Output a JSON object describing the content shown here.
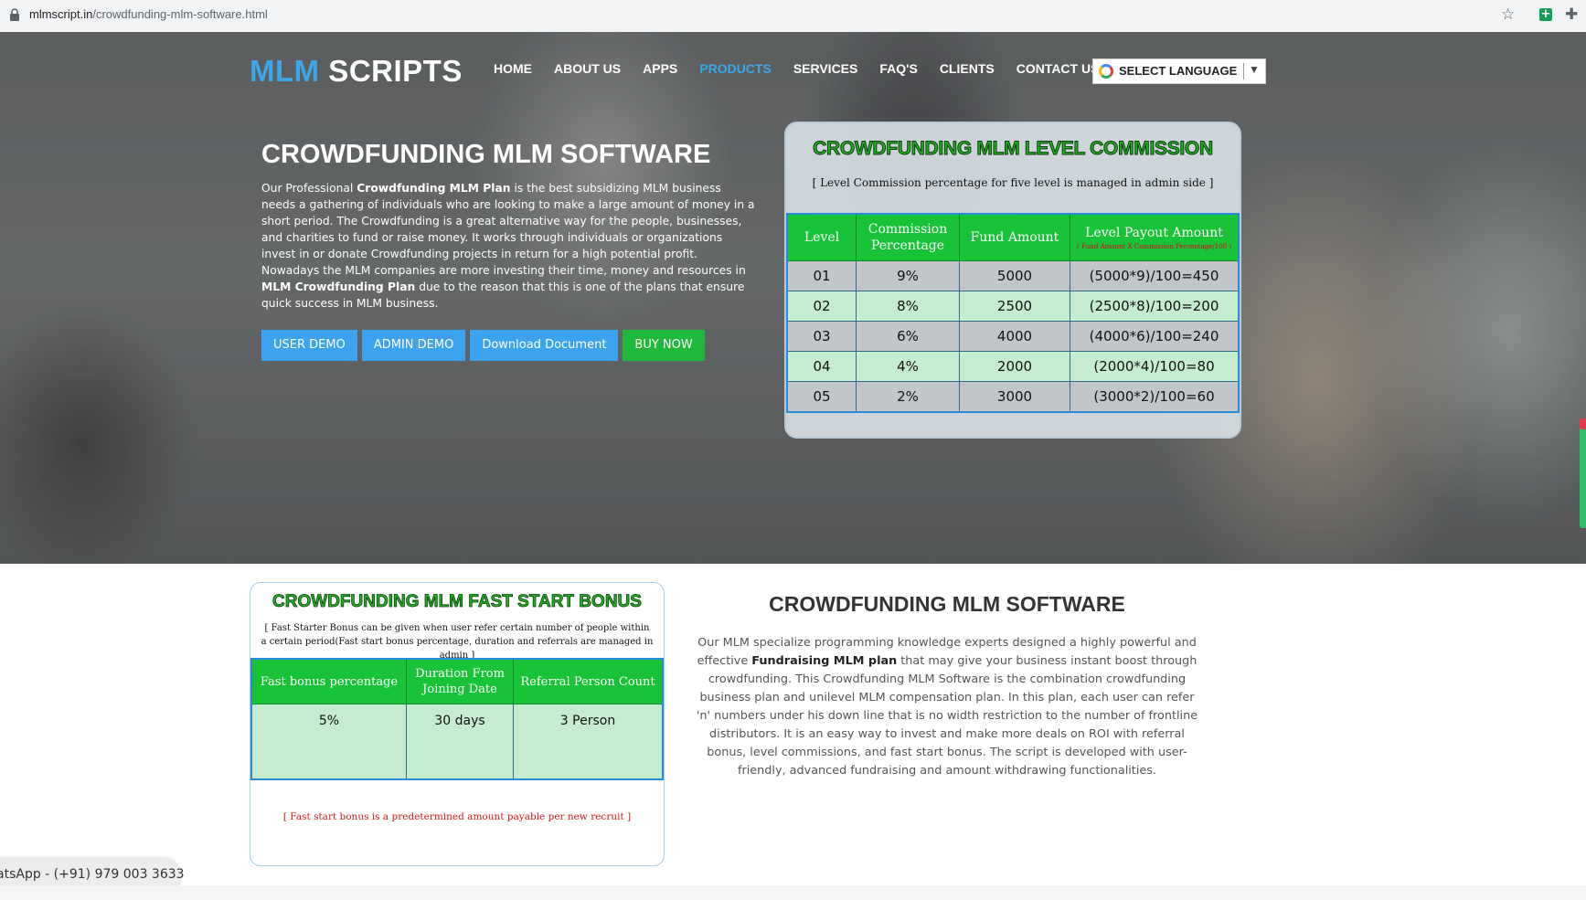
{
  "browser": {
    "url_domain": "mlmscript.in",
    "url_path": "/crowdfunding-mlm-software.html"
  },
  "logo": {
    "part1": "MLM",
    "part2": " SCRIPTS"
  },
  "nav": {
    "items": [
      {
        "label": "HOME"
      },
      {
        "label": "ABOUT US"
      },
      {
        "label": "APPS"
      },
      {
        "label": "PRODUCTS"
      },
      {
        "label": "SERVICES"
      },
      {
        "label": "FAQ'S"
      },
      {
        "label": "CLIENTS"
      },
      {
        "label": "CONTACT US"
      }
    ],
    "active_index": 3,
    "active_color": "#3ba7e8"
  },
  "language": {
    "label": "SELECT LANGUAGE",
    "arrow": "▼"
  },
  "hero": {
    "title": "CROWDFUNDING MLM SOFTWARE",
    "p1": "Our Professional ",
    "b1": "Crowdfunding MLM Plan",
    "p2": " is the best subsidizing MLM business needs a gathering of individuals who are looking to make a large amount of money in a short period. The Crowdfunding is a great alternative way for the people, businesses, and charities to fund or raise money. It works through individuals or organizations invest in or donate Crowdfunding projects in return for a high potential profit. Nowadays the MLM companies are more investing their time, money and resources in ",
    "b2": "MLM Crowdfunding Plan",
    "p3": " due to the reason that this is one of the plans that ensure quick success in MLM business.",
    "buttons": {
      "user_demo": "USER DEMO",
      "admin_demo": "ADMIN DEMO",
      "download": "Download Document",
      "buy_now": "BUY NOW"
    }
  },
  "level_commission": {
    "title": "CROWDFUNDING MLM LEVEL COMMISSION",
    "subtitle": "[   Level Commission percentage for five level is managed in admin side    ]",
    "headers": {
      "level": "Level",
      "commission_1": "Commission",
      "commission_2": "Percentage",
      "fund": "Fund Amount",
      "payout": "Level Payout Amount",
      "payout_formula": "( Fund Amount X Commission Percentage/100 )"
    },
    "rows": [
      {
        "level": "01",
        "pct": "9%",
        "fund": "5000",
        "payout": "(5000*9)/100=450"
      },
      {
        "level": "02",
        "pct": "8%",
        "fund": "2500",
        "payout": "(2500*8)/100=200"
      },
      {
        "level": "03",
        "pct": "6%",
        "fund": "4000",
        "payout": "(4000*6)/100=240"
      },
      {
        "level": "04",
        "pct": "4%",
        "fund": "2000",
        "payout": "(2000*4)/100=80"
      },
      {
        "level": "05",
        "pct": "2%",
        "fund": "3000",
        "payout": "(3000*2)/100=60"
      }
    ]
  },
  "fast_start": {
    "title": "CROWDFUNDING MLM FAST START BONUS",
    "subtitle_1": "[  Fast Starter Bonus can be given when user refer certain number of people within",
    "subtitle_2": "a certain period(Fast start bonus percentage, duration and referrals are managed in admin ]",
    "headers": {
      "bonus": "Fast bonus percentage",
      "duration_1": "Duration From",
      "duration_2": "Joining Date",
      "referral": "Referral Person Count"
    },
    "row": {
      "bonus": "5%",
      "duration": "30 days",
      "referral": "3 Person"
    },
    "note": "[   Fast start bonus is a predetermined amount payable per new recruit   ]"
  },
  "about": {
    "title": "CROWDFUNDING MLM SOFTWARE",
    "p1": "Our MLM specialize programming knowledge experts designed a highly powerful and effective ",
    "b1": "Fundraising MLM plan",
    "p2": " that may give your business instant boost through crowdfunding. This Crowdfunding MLM Software is the combination crowdfunding business plan and unilevel MLM compensation plan. In this plan, each user can refer 'n' numbers under his down line that is no width restriction to the number of frontline distributors. It is an easy way to invest and make more deals on ROI with referral bonus, level commissions, and fast start bonus. The script is developed with user-friendly, advanced fundraising and amount withdrawing functionalities."
  },
  "whatsapp": {
    "label": "atsApp - (+91) 979 003 3633"
  },
  "colors": {
    "accent": "#3ba7e8",
    "button_blue": "#3ba3f0",
    "button_green": "#1fb83c",
    "table_green": "#18c337"
  }
}
